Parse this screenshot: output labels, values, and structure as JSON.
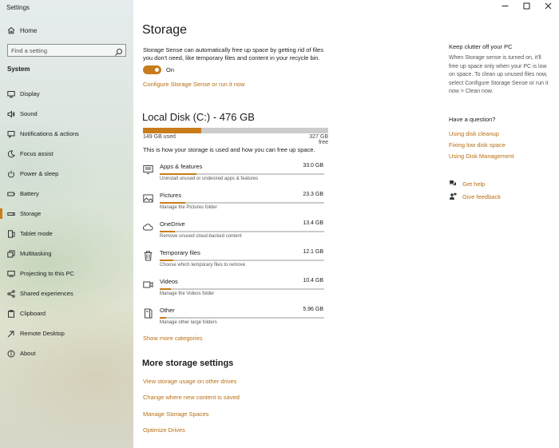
{
  "window": {
    "title": "Settings"
  },
  "window_controls": {
    "minimize_icon": "minimize-icon",
    "maximize_icon": "maximize-icon",
    "close_icon": "close-icon"
  },
  "sidebar": {
    "home": {
      "label": "Home",
      "icon": "home-icon"
    },
    "search": {
      "placeholder": "Find a setting",
      "icon": "search-icon"
    },
    "section": "System",
    "selected_index": 6,
    "items": [
      {
        "label": "Display",
        "icon": "display-icon"
      },
      {
        "label": "Sound",
        "icon": "sound-icon"
      },
      {
        "label": "Notifications & actions",
        "icon": "notifications-icon"
      },
      {
        "label": "Focus assist",
        "icon": "focus-assist-icon"
      },
      {
        "label": "Power & sleep",
        "icon": "power-icon"
      },
      {
        "label": "Battery",
        "icon": "battery-icon"
      },
      {
        "label": "Storage",
        "icon": "storage-icon"
      },
      {
        "label": "Tablet mode",
        "icon": "tablet-mode-icon"
      },
      {
        "label": "Multitasking",
        "icon": "multitasking-icon"
      },
      {
        "label": "Projecting to this PC",
        "icon": "projecting-icon"
      },
      {
        "label": "Shared experiences",
        "icon": "shared-experiences-icon"
      },
      {
        "label": "Clipboard",
        "icon": "clipboard-icon"
      },
      {
        "label": "Remote Desktop",
        "icon": "remote-desktop-icon"
      },
      {
        "label": "About",
        "icon": "info-icon"
      }
    ]
  },
  "main": {
    "title": "Storage",
    "sense_description": "Storage Sense can automatically free up space by getting rid of files you don't need, like temporary files and content in your recycle bin.",
    "toggle": {
      "state_label": "On",
      "on": true
    },
    "configure_link": "Configure Storage Sense or run it now",
    "disk": {
      "title": "Local Disk (C:) - 476 GB",
      "used_label": "149 GB used",
      "free_label": "327 GB free",
      "used_fraction": 0.313
    },
    "usage_description": "This is how your storage is used and how you can free up space.",
    "categories": [
      {
        "name": "Apps & features",
        "size": "33.0 GB",
        "description": "Uninstall unused or undesired apps & features",
        "icon": "apps-features-icon",
        "fraction": 0.221
      },
      {
        "name": "Pictures",
        "size": "23.3 GB",
        "description": "Manage the Pictures folder",
        "icon": "pictures-icon",
        "fraction": 0.156
      },
      {
        "name": "OneDrive",
        "size": "13.4 GB",
        "description": "Remove unused cloud-backed content",
        "icon": "onedrive-cloud-icon",
        "fraction": 0.09
      },
      {
        "name": "Temporary files",
        "size": "12.1 GB",
        "description": "Choose which temporary files to remove",
        "icon": "trash-icon",
        "fraction": 0.081
      },
      {
        "name": "Videos",
        "size": "10.4 GB",
        "description": "Manage the Videos folder",
        "icon": "videos-icon",
        "fraction": 0.07
      },
      {
        "name": "Other",
        "size": "5.96 GB",
        "description": "Manage other large folders",
        "icon": "other-folders-icon",
        "fraction": 0.04
      }
    ],
    "show_more": "Show more categories",
    "more_settings": {
      "title": "More storage settings",
      "links": [
        "View storage usage on other drives",
        "Change where new content is saved",
        "Manage Storage Spaces",
        "Optimize Drives"
      ]
    }
  },
  "side_panel": {
    "clutter_title": "Keep clutter off your PC",
    "clutter_text": "When Storage sense is turned on, it'll free up space only when your PC is low on space. To clean up unused files now, select Configure Storage Sense or run it now > Clean now.",
    "question_title": "Have a question?",
    "question_links": [
      "Using disk cleanup",
      "Fixing low disk space",
      "Using Disk Management"
    ],
    "help": {
      "label": "Get help",
      "icon": "get-help-icon"
    },
    "feedback": {
      "label": "Give feedback",
      "icon": "feedback-icon"
    }
  },
  "colors": {
    "accent": "#c87c1c",
    "link": "#b86e12",
    "bar_track": "#cccccc"
  }
}
